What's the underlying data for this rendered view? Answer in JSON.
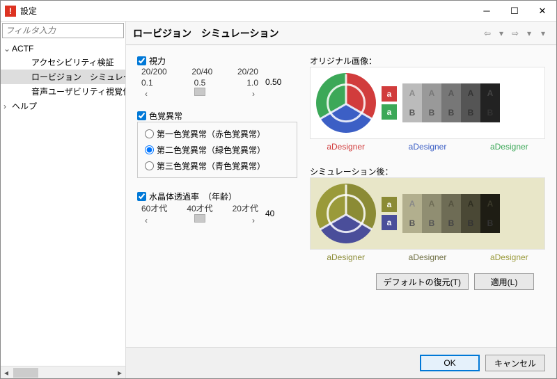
{
  "titlebar": {
    "title": "設定"
  },
  "sidebar": {
    "filter_placeholder": "フィルタ入力",
    "tree": {
      "root": "ACTF",
      "items": [
        "アクセシビリティ検証",
        "ロービジョン　シミュレーショ",
        "音声ユーザビリティ視覚化"
      ],
      "help": "ヘルプ"
    }
  },
  "header": {
    "title": "ロービジョン　シミュレーション"
  },
  "vision": {
    "label": "視力",
    "ticks_top": [
      "20/200",
      "20/40",
      "20/20"
    ],
    "ticks_bottom": [
      "0.1",
      "0.5",
      "1.0"
    ],
    "value": "0.50"
  },
  "color": {
    "label": "色覚異常",
    "options": [
      "第一色覚異常（赤色覚異常）",
      "第二色覚異常（緑色覚異常）",
      "第三色覚異常（青色覚異常）"
    ]
  },
  "lens": {
    "label": "水晶体透過率　（年齢）",
    "ticks": [
      "60才代",
      "40才代",
      "20才代"
    ],
    "value": "40"
  },
  "preview": {
    "original_label": "オリジナル画像：",
    "sim_label": "シミュレーション後：",
    "swatch_text": "a",
    "gray_top": "A",
    "gray_bot": "B",
    "designer": "aDesigner"
  },
  "buttons": {
    "restore": "デフォルトの復元(T)",
    "apply": "適用(L)",
    "ok": "OK",
    "cancel": "キャンセル"
  }
}
